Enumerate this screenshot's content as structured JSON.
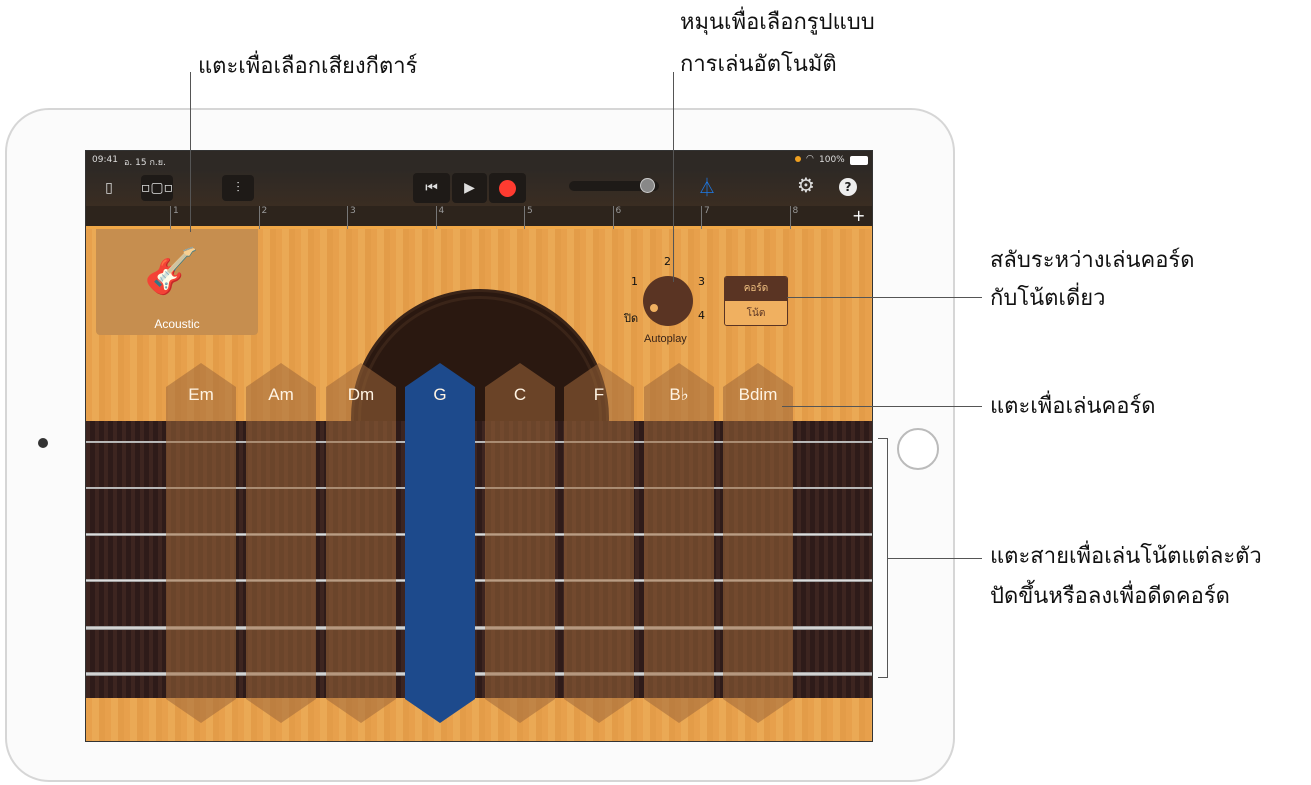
{
  "status": {
    "time": "09:41",
    "date": "อ. 15 ก.ย.",
    "battery": "100%"
  },
  "ruler": {
    "marks": [
      "1",
      "2",
      "3",
      "4",
      "5",
      "6",
      "7",
      "8"
    ],
    "add": "+"
  },
  "instrument": {
    "name": "Acoustic"
  },
  "autoplay": {
    "label": "Autoplay",
    "positions": [
      "ปิด",
      "1",
      "2",
      "3",
      "4"
    ],
    "value": "ปิด"
  },
  "mode": {
    "chords": "คอร์ด",
    "notes": "โน้ต",
    "selected": "คอร์ด"
  },
  "chords": [
    {
      "label": "Em"
    },
    {
      "label": "Am"
    },
    {
      "label": "Dm"
    },
    {
      "label": "G",
      "selected": true
    },
    {
      "label": "C"
    },
    {
      "label": "F"
    },
    {
      "label": "B♭"
    },
    {
      "label": "Bdim"
    }
  ],
  "annotations": {
    "select_sound": "แตะเพื่อเลือกเสียงกีตาร์",
    "autoplay_1": "หมุนเพื่อเลือกรูปแบบ",
    "autoplay_2": "การเล่นอัตโนมัติ",
    "switch_1": "สลับระหว่างเล่นคอร์ด",
    "switch_2": "กับโน้ตเดี่ยว",
    "play_chord": "แตะเพื่อเล่นคอร์ด",
    "strings_1": "แตะสายเพื่อเล่นโน้ตแต่ละตัว",
    "strings_2": "ปัดขึ้นหรือลงเพื่อดีดคอร์ด"
  },
  "colors": {
    "accent": "#1d7bea",
    "record": "#ff3b30",
    "wood": "#e9a650",
    "selected_chord": "#1d4a8c",
    "knob": "#5a3423"
  }
}
